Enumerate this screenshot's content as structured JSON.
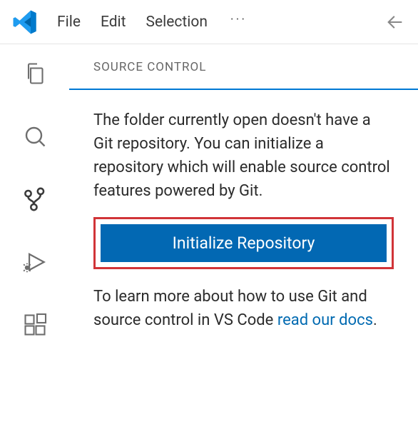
{
  "menubar": {
    "items": [
      "File",
      "Edit",
      "Selection"
    ],
    "overflow": "···"
  },
  "activitybar": {
    "icons": [
      {
        "name": "explorer-icon"
      },
      {
        "name": "search-icon"
      },
      {
        "name": "source-control-icon",
        "active": true
      },
      {
        "name": "run-debug-icon"
      },
      {
        "name": "extensions-icon"
      }
    ]
  },
  "sidebar": {
    "title": "SOURCE CONTROL",
    "intro_text": "The folder currently open doesn't have a Git repository. You can initialize a repository which will enable source control features powered by Git.",
    "button_label": "Initialize Repository",
    "learn_more_prefix": "To learn more about how to use Git and source control in VS Code ",
    "learn_more_link": "read our docs",
    "learn_more_suffix": "."
  },
  "colors": {
    "accent": "#0078d4",
    "button": "#0268b3",
    "highlight": "#d13438",
    "link": "#006ab1"
  }
}
